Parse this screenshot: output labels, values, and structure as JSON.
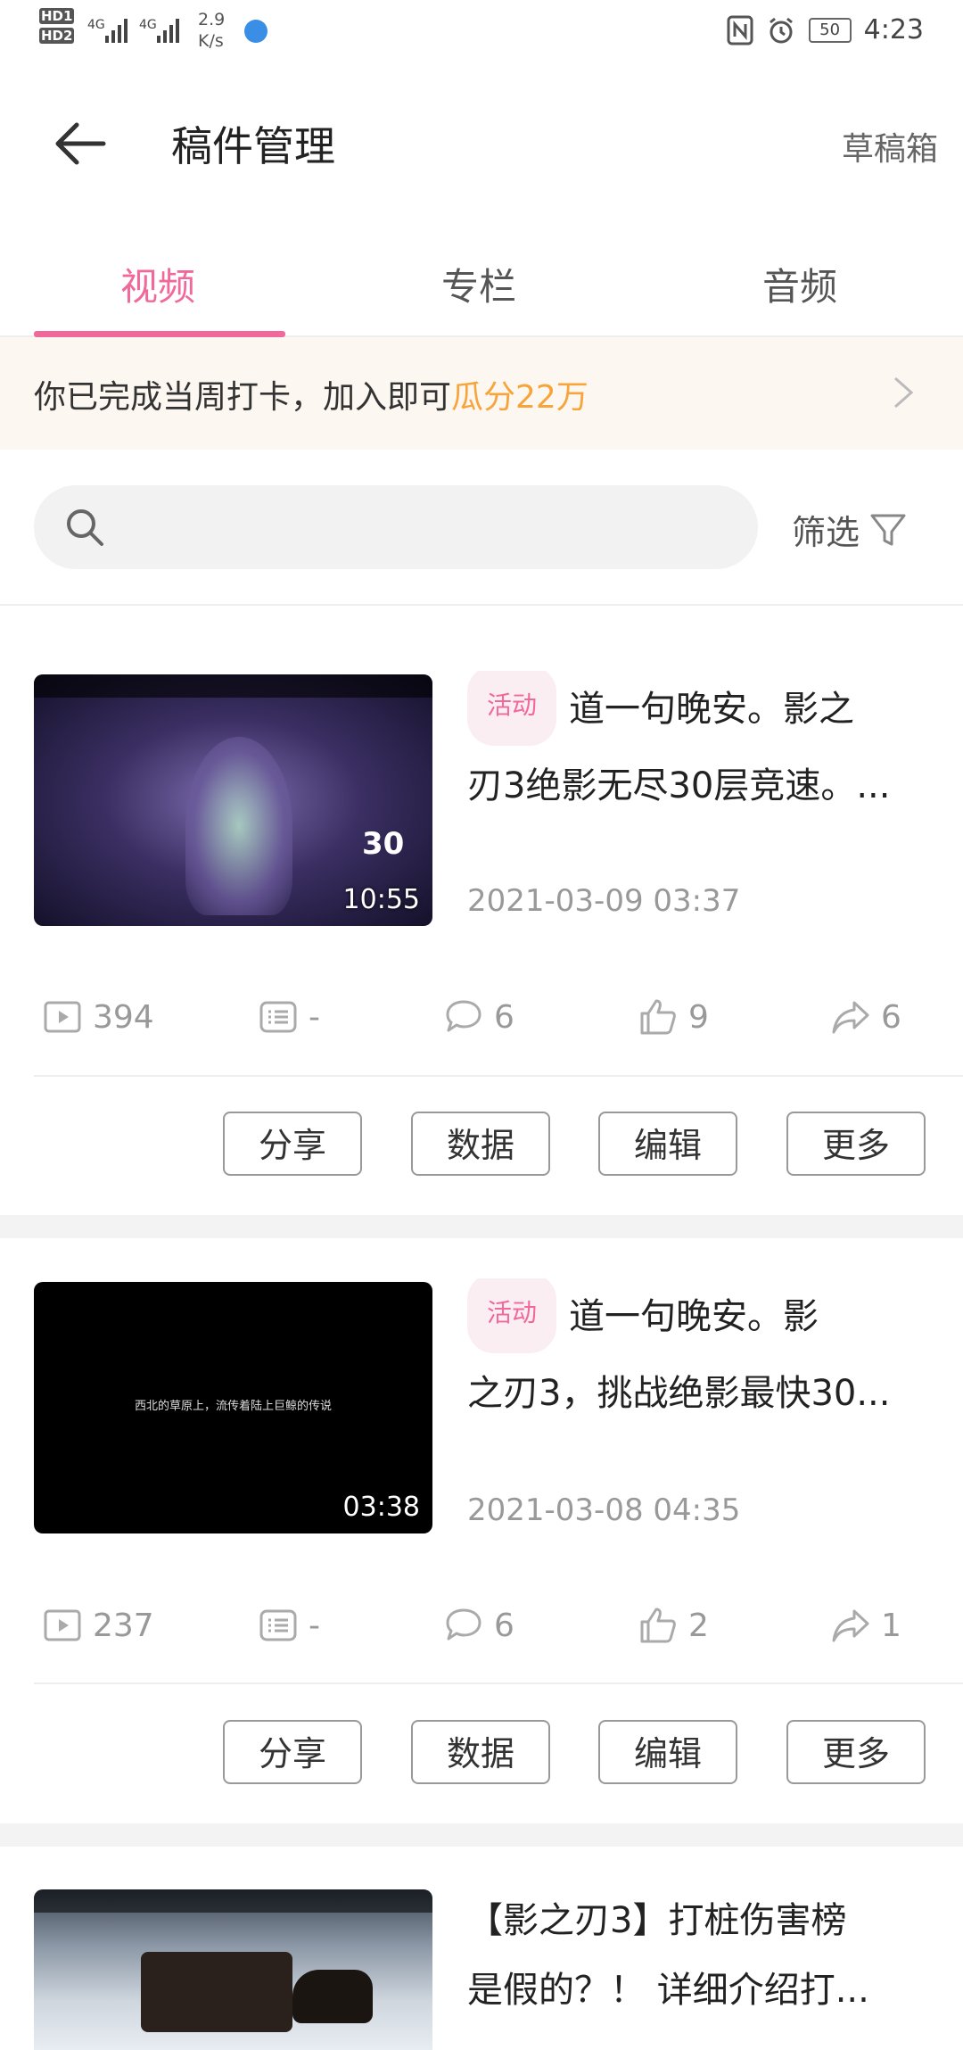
{
  "status_bar": {
    "hd1": "HD1",
    "hd2": "HD2",
    "net1": "4G",
    "net2": "4G",
    "speed_value": "2.9",
    "speed_unit": "K/s",
    "battery": "50",
    "time": "4:23"
  },
  "header": {
    "title": "稿件管理",
    "draft_box": "草稿箱"
  },
  "tabs": [
    {
      "label": "视频",
      "active": true
    },
    {
      "label": "专栏",
      "active": false
    },
    {
      "label": "音频",
      "active": false
    }
  ],
  "banner": {
    "text": "你已完成当周打卡，加入即可",
    "highlight": "瓜分22万"
  },
  "search": {
    "placeholder": "",
    "filter_label": "筛选"
  },
  "items": [
    {
      "tag": "活动",
      "title_line1": "道一句晚安。影之",
      "title_line2": "刃3绝影无尽30层竞速。...",
      "duration": "10:55",
      "date": "2021-03-09 03:37",
      "plays": "394",
      "danmaku": "-",
      "comments": "6",
      "likes": "9",
      "shares": "6",
      "thumb_overlay": "30"
    },
    {
      "tag": "活动",
      "title_line1": "道一句晚安。影",
      "title_line2": "之刃3，挑战绝影最快30...",
      "duration": "03:38",
      "date": "2021-03-08 04:35",
      "plays": "237",
      "danmaku": "-",
      "comments": "6",
      "likes": "2",
      "shares": "1",
      "thumb_overlay": "西北的草原上，流传着陆上巨鲸的传说"
    },
    {
      "title_line1": "【影之刃3】打桩伤害榜",
      "title_line2": "是假的？！ 详细介绍打..."
    }
  ],
  "actions": {
    "share": "分享",
    "data": "数据",
    "edit": "编辑",
    "more": "更多"
  },
  "colors": {
    "accent": "#f0699a",
    "highlight": "#f7a53b",
    "banner_bg": "#fdf7f2"
  }
}
